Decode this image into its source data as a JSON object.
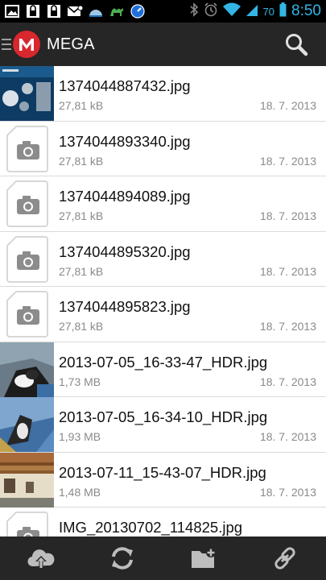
{
  "status_bar": {
    "battery_percent": "70",
    "time": "8:50"
  },
  "action_bar": {
    "title": "MEGA"
  },
  "files": [
    {
      "name": "1374044887432.jpg",
      "size": "27,81 kB",
      "date": "18. 7. 2013",
      "thumb": "screenshot-thumbnail"
    },
    {
      "name": "1374044893340.jpg",
      "size": "27,81 kB",
      "date": "18. 7. 2013",
      "thumb": "generic-image-icon"
    },
    {
      "name": "1374044894089.jpg",
      "size": "27,81 kB",
      "date": "18. 7. 2013",
      "thumb": "generic-image-icon"
    },
    {
      "name": "1374044895320.jpg",
      "size": "27,81 kB",
      "date": "18. 7. 2013",
      "thumb": "generic-image-icon"
    },
    {
      "name": "1374044895823.jpg",
      "size": "27,81 kB",
      "date": "18. 7. 2013",
      "thumb": "generic-image-icon"
    },
    {
      "name": "2013-07-05_16-33-47_HDR.jpg",
      "size": "1,73 MB",
      "date": "18. 7. 2013",
      "thumb": "photo-thumbnail"
    },
    {
      "name": "2013-07-05_16-34-10_HDR.jpg",
      "size": "1,93 MB",
      "date": "18. 7. 2013",
      "thumb": "photo-thumbnail"
    },
    {
      "name": "2013-07-11_15-43-07_HDR.jpg",
      "size": "1,48 MB",
      "date": "18. 7. 2013",
      "thumb": "photo-thumbnail"
    },
    {
      "name": "IMG_20130702_114825.jpg",
      "size": "",
      "date": "",
      "thumb": "generic-image-icon"
    }
  ],
  "toolbar": {
    "buttons": [
      "upload-icon",
      "refresh-icon",
      "new-folder-icon",
      "link-icon"
    ]
  },
  "colors": {
    "bar_background": "#262626",
    "brand_red": "#d9272e",
    "status_accent": "#33b5e5"
  }
}
